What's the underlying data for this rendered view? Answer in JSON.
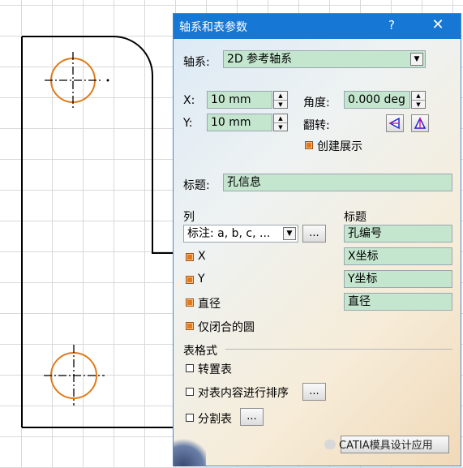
{
  "dialog": {
    "title": "轴系和表参数",
    "help_glyph": "?",
    "close_glyph": "✕",
    "axis": {
      "label": "轴系:",
      "value": "2D 参考轴系"
    },
    "x": {
      "label": "X:",
      "value": "10 mm"
    },
    "y": {
      "label": "Y:",
      "value": "10 mm"
    },
    "angle": {
      "label": "角度:",
      "value": "0.000 deg"
    },
    "flip": {
      "label": "翻转:"
    },
    "create_expand": {
      "label": "创建展示",
      "checked": true
    },
    "title_field": {
      "label": "标题:",
      "value": "孔信息"
    },
    "columns": {
      "label": "列",
      "heading_label": "标题",
      "annotation_combo": "标注: a, b, c, ...",
      "annotation_title": "孔编号",
      "rows": [
        {
          "label": "X",
          "title": "X坐标",
          "checked": true
        },
        {
          "label": "Y",
          "title": "Y坐标",
          "checked": true
        },
        {
          "label": "直径",
          "title": "直径",
          "checked": true
        }
      ],
      "closed_circles_only": {
        "label": "仅闭合的圆",
        "checked": true
      }
    },
    "table_format": {
      "label": "表格式",
      "transpose": {
        "label": "转置表",
        "checked": false
      },
      "sort": {
        "label": "对表内容进行排序",
        "checked": false
      },
      "split": {
        "label": "分割表",
        "checked": false
      }
    },
    "ellipsis": "...",
    "watermark": "CATIA模具设计应用"
  },
  "colors": {
    "titlebar": "#1677d4",
    "field_bg": "#c4e6cf",
    "hole": "#e07b1a",
    "checkbox_on": "#e07a1a"
  }
}
